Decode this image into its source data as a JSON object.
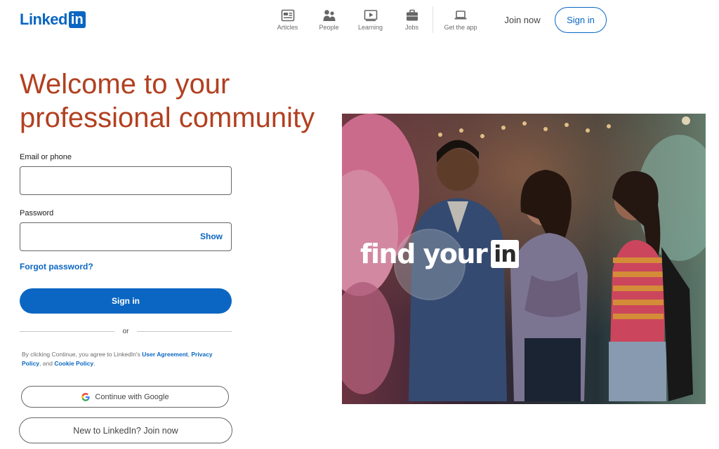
{
  "header": {
    "logo_text": "Linked",
    "logo_box": "in",
    "nav": [
      {
        "label": "Articles",
        "icon": "articles-icon"
      },
      {
        "label": "People",
        "icon": "people-icon"
      },
      {
        "label": "Learning",
        "icon": "learning-icon"
      },
      {
        "label": "Jobs",
        "icon": "jobs-icon"
      }
    ],
    "get_app": "Get the app",
    "join_now": "Join now",
    "sign_in": "Sign in"
  },
  "hero": {
    "title": "Welcome to your professional community"
  },
  "form": {
    "email_label": "Email or phone",
    "email_value": "",
    "password_label": "Password",
    "password_value": "",
    "show_label": "Show",
    "forgot": "Forgot password?",
    "sign_in": "Sign in",
    "or": "or",
    "legal_prefix": "By clicking Continue, you agree to LinkedIn's ",
    "user_agreement": "User Agreement",
    "privacy_policy": "Privacy Policy",
    "legal_and": ", and ",
    "cookie_policy": "Cookie Policy",
    "legal_end": ".",
    "google": "Continue with Google",
    "join": "New to LinkedIn? Join now"
  },
  "image": {
    "caption_text": "find your",
    "caption_box": "in"
  },
  "colors": {
    "brand": "#0a66c2",
    "title": "#b24020"
  }
}
